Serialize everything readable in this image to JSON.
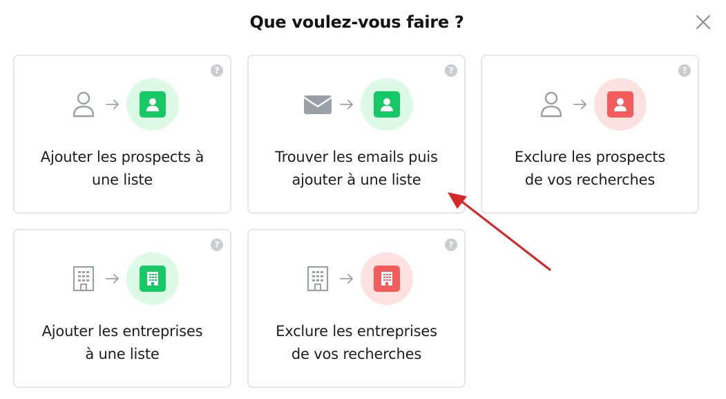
{
  "dialog": {
    "title": "Que voulez-vous faire ?"
  },
  "help_glyph": "?",
  "cards": [
    {
      "line1": "Ajouter les prospects à",
      "line2": "une liste",
      "source": "person-icon",
      "target": "person-badge-icon",
      "tone": "green"
    },
    {
      "line1": "Trouver les emails puis",
      "line2": "ajouter à une liste",
      "source": "envelope-icon",
      "target": "person-badge-icon",
      "tone": "green"
    },
    {
      "line1": "Exclure les prospects",
      "line2": "de vos recherches",
      "source": "person-icon",
      "target": "person-badge-icon",
      "tone": "red"
    },
    {
      "line1": "Ajouter les entreprises",
      "line2": "à une liste",
      "source": "building-icon",
      "target": "building-badge-icon",
      "tone": "green"
    },
    {
      "line1": "Exclure les entreprises",
      "line2": "de vos recherches",
      "source": "building-icon",
      "target": "building-badge-icon",
      "tone": "red"
    }
  ],
  "colors": {
    "green_bg": "#dcfae6",
    "green": "#17c964",
    "red_bg": "#fde0e0",
    "red": "#f25c5c",
    "annotation": "#d62828"
  }
}
